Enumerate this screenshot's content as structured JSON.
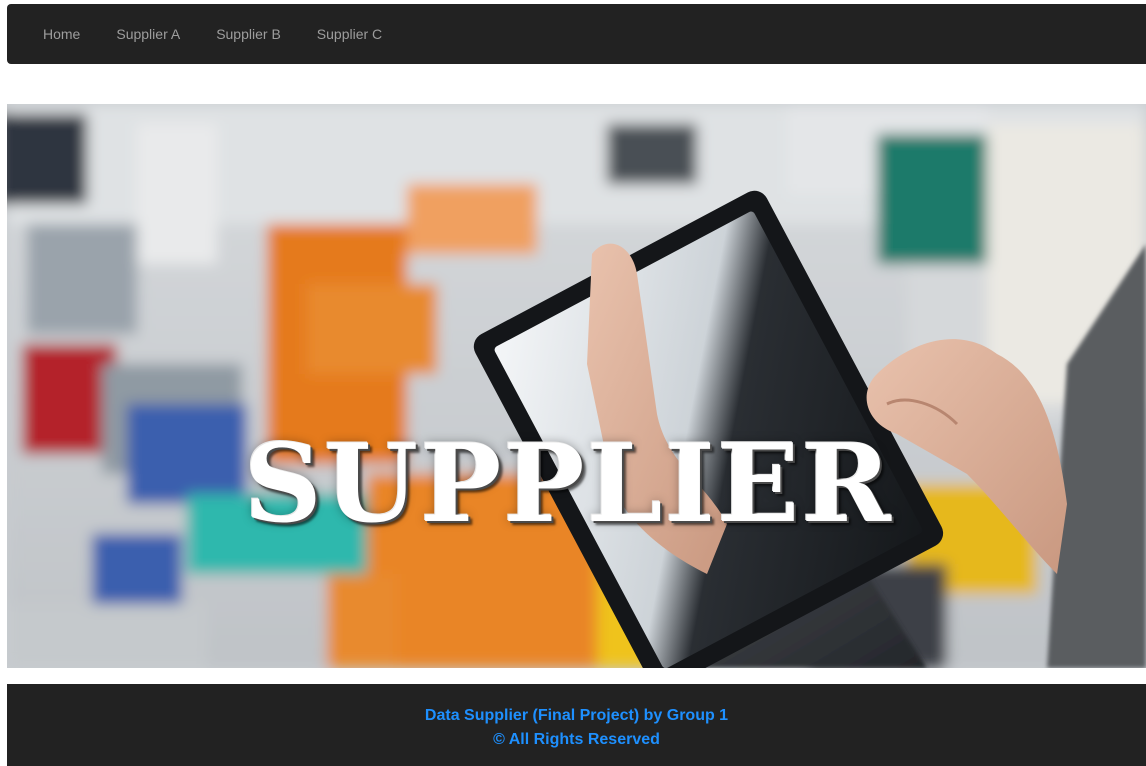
{
  "navbar": {
    "items": [
      {
        "label": "Home"
      },
      {
        "label": "Supplier A"
      },
      {
        "label": "Supplier B"
      },
      {
        "label": "Supplier C"
      }
    ]
  },
  "hero": {
    "title": "SUPPLIER"
  },
  "footer": {
    "line1": "Data Supplier (Final Project) by Group 1",
    "line2": "© All Rights Reserved",
    "text_color": "#1e90ff"
  },
  "colors": {
    "navbar_bg": "#222222",
    "nav_text": "#9d9d9d",
    "footer_bg": "#222222"
  }
}
